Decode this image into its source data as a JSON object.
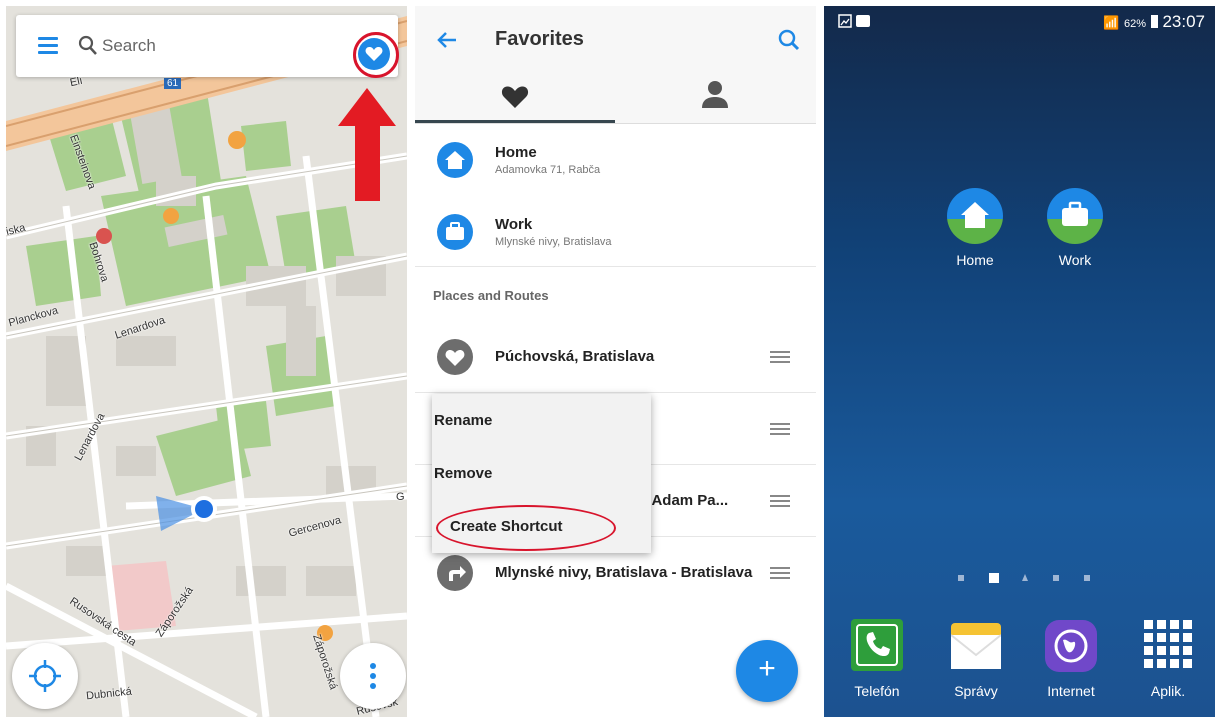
{
  "map_panel": {
    "search": {
      "placeholder": "Search"
    },
    "route_badge": "61",
    "streets": [
      "Einsteinova",
      "Bohrova",
      "Lenardova",
      "Planckova",
      "Lenardova",
      "Gercenova",
      "Rusovská cesta",
      "Záporožská",
      "Záporožská",
      "Dubnická",
      "Rusovsk",
      "G",
      "Eli",
      "iska"
    ]
  },
  "favorites_panel": {
    "title": "Favorites",
    "tabs": [
      {
        "icon": "heart-icon"
      },
      {
        "icon": "person-icon"
      }
    ],
    "items": [
      {
        "title": "Home",
        "subtitle": "Adamovka 71, Rabča",
        "icon": "home-icon"
      },
      {
        "title": "Work",
        "subtitle": "Mlynské nivy, Bratislava",
        "icon": "briefcase-icon"
      }
    ],
    "section_label": "Places and Routes",
    "places": [
      {
        "title": "Púchovská, Bratislava",
        "icon": "heart-icon"
      },
      {
        "title": "",
        "icon": ""
      },
      {
        "title": "va - Adam Pa...",
        "icon": ""
      },
      {
        "title": "Mlynské nivy, Bratislava - Bratislava",
        "icon": "route-icon"
      }
    ],
    "context_menu": [
      "Rename",
      "Remove",
      "Create Shortcut"
    ],
    "fab_label": "+"
  },
  "home_panel": {
    "status": {
      "battery": "62%",
      "time": "23:07"
    },
    "apps": [
      {
        "label": "Home",
        "icon": "home-icon"
      },
      {
        "label": "Work",
        "icon": "briefcase-icon"
      }
    ],
    "dock": [
      {
        "label": "Telefón",
        "icon": "phone-icon"
      },
      {
        "label": "Správy",
        "icon": "messages-icon"
      },
      {
        "label": "Internet",
        "icon": "internet-icon"
      },
      {
        "label": "Aplik.",
        "icon": "apps-grid-icon"
      }
    ]
  },
  "colors": {
    "accent": "#1e88e5",
    "annotation": "#d8142c",
    "park": "#a8cf8e",
    "map_bg": "#e4e2dc"
  }
}
